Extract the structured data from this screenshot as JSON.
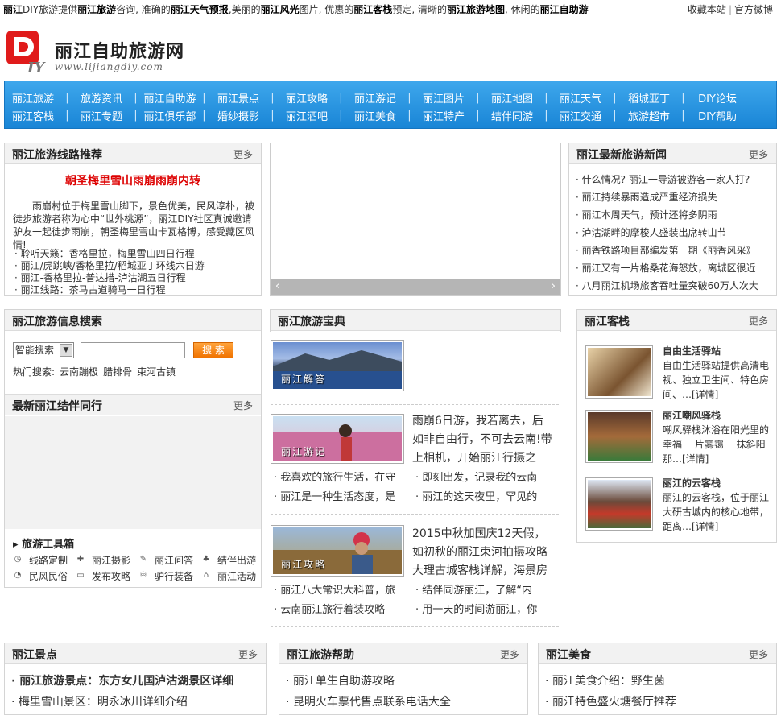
{
  "topbar": {
    "intro_parts": [
      {
        "text": "丽江",
        "bold": true
      },
      {
        "text": "DIY旅游提供",
        "bold": false
      },
      {
        "text": "丽江旅游",
        "bold": true
      },
      {
        "text": "咨询, 准确的",
        "bold": false
      },
      {
        "text": "丽江天气预报",
        "bold": true
      },
      {
        "text": ",美丽的",
        "bold": false
      },
      {
        "text": "丽江风光",
        "bold": true
      },
      {
        "text": "图片, 优惠的",
        "bold": false
      },
      {
        "text": "丽江客栈",
        "bold": true
      },
      {
        "text": "预定, 清晰的",
        "bold": false
      },
      {
        "text": "丽江旅游地图",
        "bold": true
      },
      {
        "text": ", 休闲的",
        "bold": false
      },
      {
        "text": "丽江自助游",
        "bold": true
      }
    ],
    "bookmark": "收藏本站",
    "sep": "|",
    "weibo": "官方微博"
  },
  "logo": {
    "name": "丽江自助旅游网",
    "url": "www.lijiangdiy.com"
  },
  "nav": {
    "row1": [
      "丽江旅游",
      "旅游资讯",
      "丽江自助游",
      "丽江景点",
      "丽江攻略",
      "丽江游记",
      "丽江图片",
      "丽江地图",
      "丽江天气",
      "稻城亚丁",
      "DIY论坛"
    ],
    "row2": [
      "丽江客栈",
      "丽江专题",
      "丽江俱乐部",
      "婚纱摄影",
      "丽江酒吧",
      "丽江美食",
      "丽江特产",
      "结伴同游",
      "丽江交通",
      "旅游超市",
      "DIY帮助"
    ],
    "sep": "|"
  },
  "route_box": {
    "title": "丽江旅游线路推荐",
    "more": "更多",
    "feature_title": "朝圣梅里雪山雨崩雨崩内转",
    "feature_text": "雨崩村位于梅里雪山脚下，景色优美，民风淳朴，被徒步旅游者称为心中“世外桃源”，丽江DIY社区真诚邀请驴友一起徒步雨崩，朝圣梅里雪山卡瓦格博，感受藏区风情!",
    "links": [
      "聆听天籁：香格里拉，梅里雪山四日行程",
      "丽江/虎跳峡/香格里拉/稻城亚丁环线六日游",
      "丽江-香格里拉-普达措-泸沽湖五日行程",
      "丽江线路：茶马古道骑马一日行程"
    ]
  },
  "slider": {
    "prev": "‹",
    "next": "›"
  },
  "news_box": {
    "title": "丽江最新旅游新闻",
    "more": "更多",
    "items": [
      "什么情况? 丽江一导游被游客一家人打?",
      "丽江持续暴雨造成严重经济损失",
      "丽江本周天气，预计还将多阴雨",
      "泸沽湖畔的摩梭人盛装出席转山节",
      "丽香铁路项目部编发第一期《丽香风采》",
      "丽江又有一片格桑花海怒放，离城区很近",
      "八月丽江机场旅客吞吐量突破60万人次大"
    ]
  },
  "search_box": {
    "title": "丽江旅游信息搜索",
    "select_value": "智能搜索",
    "button": "搜 索",
    "hot_label": "热门搜索:",
    "hot": [
      "云南蹦极",
      "腊排骨",
      "束河古镇"
    ]
  },
  "partner_box": {
    "title": "最新丽江结伴同行",
    "more": "更多"
  },
  "tools": {
    "title": "旅游工具箱",
    "items": [
      {
        "icon": "route-icon",
        "glyph": "◷",
        "label": "线路定制"
      },
      {
        "icon": "camera-icon",
        "glyph": "✚",
        "label": "丽江摄影"
      },
      {
        "icon": "qa-icon",
        "glyph": "✎",
        "label": "丽江问答"
      },
      {
        "icon": "group-icon",
        "glyph": "♣",
        "label": "结伴出游"
      },
      {
        "icon": "inn-icon",
        "glyph": "◔",
        "label": "民风民俗"
      },
      {
        "icon": "map-icon",
        "glyph": "▭",
        "label": "发布攻略"
      },
      {
        "icon": "gear-icon",
        "glyph": "♾",
        "label": "驴行装备"
      },
      {
        "icon": "home-icon",
        "glyph": "⌂",
        "label": "丽江活动"
      }
    ]
  },
  "baodian": {
    "title": "丽江旅游宝典",
    "card1": {
      "label": "丽江解答"
    },
    "card2": {
      "label": "丽江游记",
      "text": "雨崩6日游，我若离去，后如非自由行，不可去云南!带上相机，开始丽江行摄之",
      "sub": [
        "我喜欢的旅行生活，在守",
        "即刻出发，记录我的云南",
        "丽江是一种生活态度，是",
        "丽江的这天夜里，罕见的"
      ]
    },
    "card3": {
      "label": "丽江攻略",
      "text": "2015中秋加国庆12天假，如初秋的丽江束河拍摄攻略大理古城客栈详解，海景房",
      "sub": [
        "丽江八大常识大科普，旅",
        "结伴同游丽江，了解“内",
        "云南丽江旅行着装攻略",
        "用一天的时间游丽江，你"
      ]
    }
  },
  "inn_box": {
    "title": "丽江客栈",
    "more": "更多",
    "items": [
      {
        "name": "自由生活驿站",
        "desc": "自由生活驿站提供高清电视、独立卫生间、特色房间、…[详情]"
      },
      {
        "name": "丽江嘲风驿栈",
        "desc": "嘲风驿栈沐浴在阳光里的幸福 一片雾霭 一抹斜阳那…[详情]"
      },
      {
        "name": "丽江的云客栈",
        "desc": "丽江的云客栈，位于丽江大研古城内的核心地带，距离…[详情]"
      }
    ]
  },
  "spots_box": {
    "title": "丽江景点",
    "more": "更多",
    "items": [
      "丽江旅游景点：东方女儿国泸沽湖景区详细",
      "梅里雪山景区：明永冰川详细介绍"
    ]
  },
  "help_box": {
    "title": "丽江旅游帮助",
    "more": "更多",
    "items": [
      "丽江单生自助游攻略",
      "昆明火车票代售点联系电话大全"
    ]
  },
  "food_box": {
    "title": "丽江美食",
    "more": "更多",
    "items": [
      "丽江美食介绍：野生菌",
      "丽江特色盛火塘餐厅推荐"
    ]
  },
  "colors": {
    "nav_blue": "#1e8ad8",
    "feature_red": "#dd0000",
    "search_orange": "#f07300"
  }
}
